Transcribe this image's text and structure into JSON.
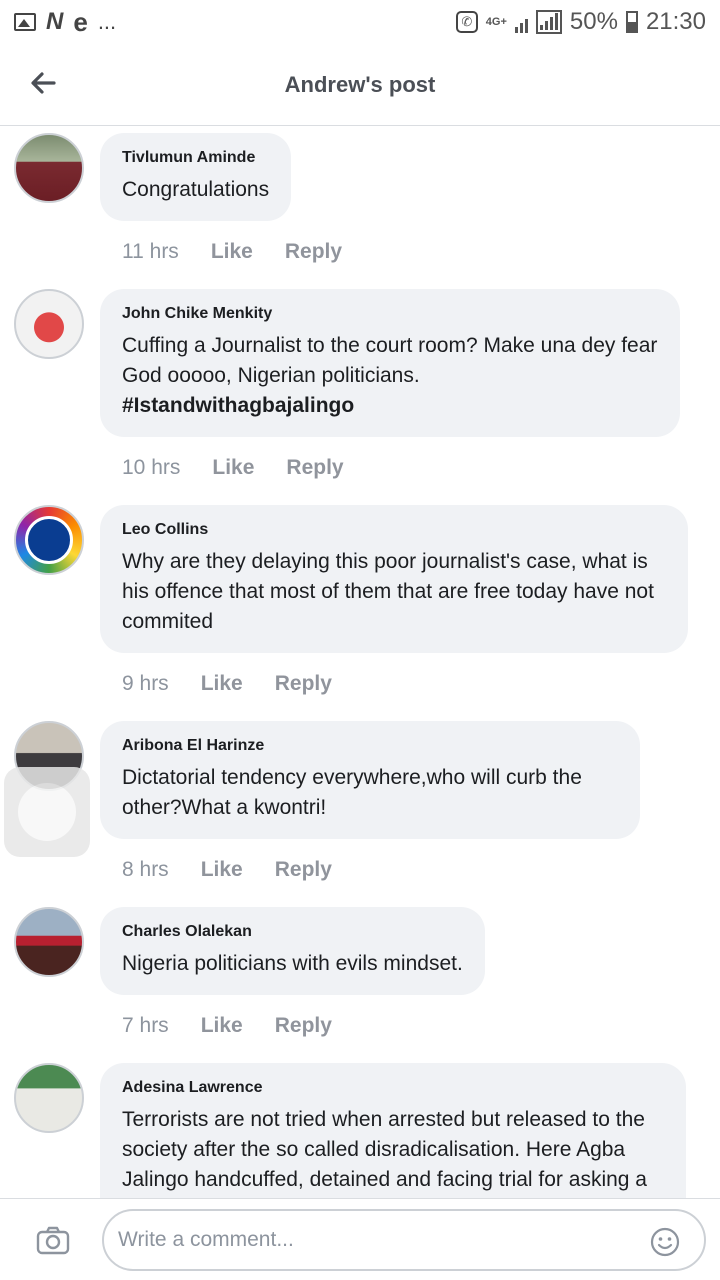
{
  "status_bar": {
    "carrier_letters": [
      "N",
      "e"
    ],
    "more": "...",
    "network": "4G+",
    "battery": "50%",
    "time": "21:30"
  },
  "header": {
    "title": "Andrew's post"
  },
  "comments": [
    {
      "author": "Tivlumun Aminde",
      "text": "Congratulations",
      "time": "11 hrs",
      "like": "Like",
      "reply": "Reply"
    },
    {
      "author": "John Chike Menkity",
      "text": "Cuffing a Journalist to the court room? Make una dey fear God ooooo, Nigerian politicians.",
      "hashtag": "#Istandwithagbajalingo",
      "time": "10 hrs",
      "like": "Like",
      "reply": "Reply"
    },
    {
      "author": "Leo Collins",
      "text": "Why are they delaying this poor journalist's case, what is his offence that most of them that are free today have not commited",
      "time": "9 hrs",
      "like": "Like",
      "reply": "Reply"
    },
    {
      "author": "Aribona El Harinze",
      "text": "Dictatorial tendency everywhere,who will curb the other?What a kwontri!",
      "time": "8 hrs",
      "like": "Like",
      "reply": "Reply"
    },
    {
      "author": "Charles Olalekan",
      "text": "Nigeria politicians with evils mindset.",
      "time": "7 hrs",
      "like": "Like",
      "reply": "Reply"
    },
    {
      "author": "Adesina Lawrence",
      "text": "Terrorists are not tried when arrested but released to the society after the so called disradicalisation. Here Agba Jalingo handcuffed, detained and facing trial for asking a question on accountability.\nHis constituency \" the journalism profession\" is not doing enough to support him. His fellow citizens keep"
    }
  ],
  "composer": {
    "placeholder": "Write a comment..."
  },
  "icons": {
    "back": "arrow-left-icon",
    "camera": "camera-icon",
    "emoji": "emoji-icon"
  }
}
